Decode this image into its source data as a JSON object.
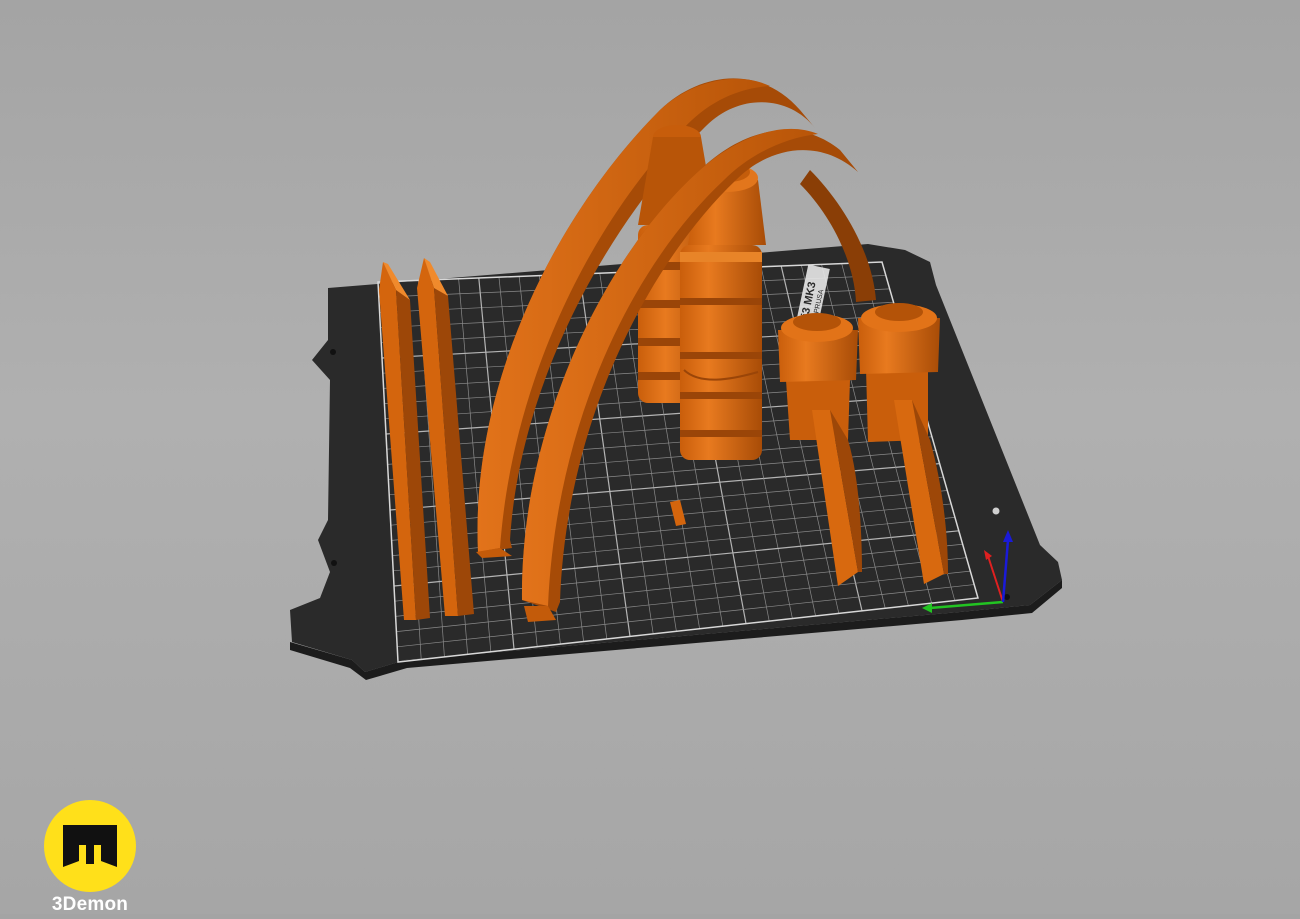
{
  "viewport": {
    "bed_label_lines": [
      "i3 MK3",
      "PRUSA"
    ],
    "colors": {
      "background": "#a8a8a8",
      "bed": "#2b2b2b",
      "grid": "#8a8a8a",
      "model": "#d9690f",
      "model_dark": "#9a4508",
      "axis_x": "#e02020",
      "axis_y": "#22c422",
      "axis_z": "#1a1ad8"
    },
    "icons": {
      "x_axis": "x-axis-arrow-icon",
      "y_axis": "y-axis-arrow-icon",
      "z_axis": "z-axis-arrow-icon"
    }
  },
  "watermark": {
    "brand": "3Demon",
    "icon": "3demon-logo-icon",
    "color": "#ffe01a"
  }
}
